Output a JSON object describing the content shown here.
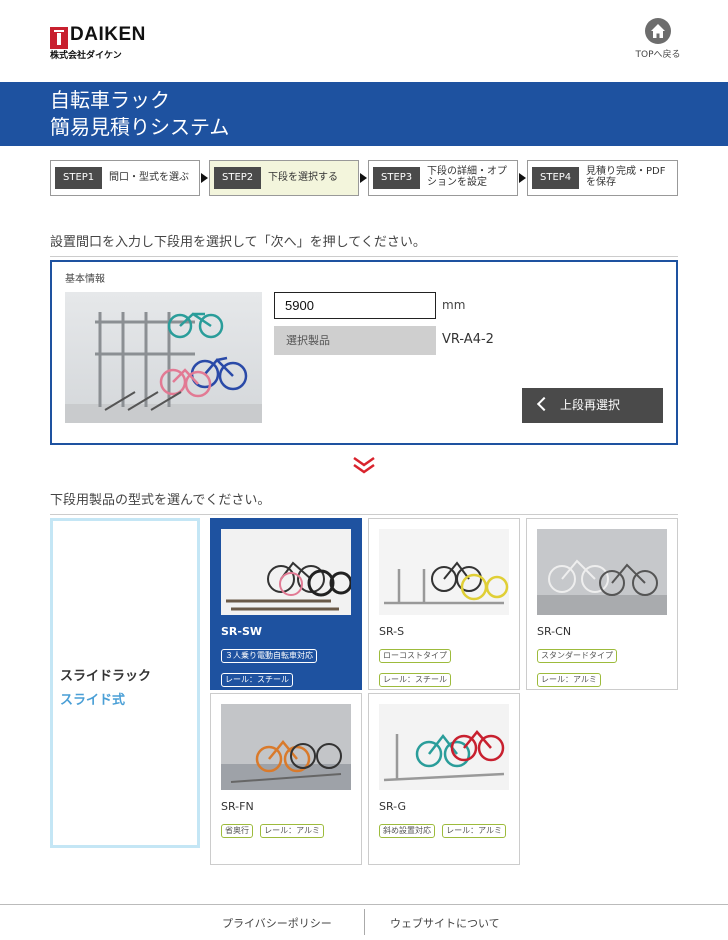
{
  "header": {
    "brand": "DAIKEN",
    "company": "株式会社ダイケン",
    "top_label": "TOPへ戻る",
    "top_icon": "home-icon"
  },
  "banner": {
    "title_line1": "自転車ラック",
    "title_line2": "簡易見積りシステム",
    "bg_color": "#1e52a0"
  },
  "steps": [
    {
      "badge": "STEP1",
      "text": [
        "間口・型式を選ぶ"
      ],
      "active": false
    },
    {
      "badge": "STEP2",
      "text": [
        "下段を選択する"
      ],
      "active": true
    },
    {
      "badge": "STEP3",
      "text": [
        "下段の詳細・オプ",
        "ションを設定"
      ],
      "active": false
    },
    {
      "badge": "STEP4",
      "text": [
        "見積り完成・PDF",
        "を保存"
      ],
      "active": false
    }
  ],
  "instruction": "設置間口を入力し下段用を選択して「次へ」を押してください。",
  "basic_info": {
    "label": "基本情報",
    "width_value": "5900",
    "unit": "mm",
    "selected_label": "選択製品",
    "selected_value": "VR-A4-2",
    "reselect_button": "上段再選択"
  },
  "lower_section": {
    "heading": "下段用製品の型式を選んでください。",
    "category_name": "スライドラック",
    "category_type": "スライド式"
  },
  "products": [
    {
      "name": "SR-SW",
      "tags": [
        "３人乗り電動自転車対応",
        "レール：スチール"
      ],
      "selected": true
    },
    {
      "name": "SR-S",
      "tags": [
        "ローコストタイプ",
        "レール：スチール"
      ],
      "selected": false
    },
    {
      "name": "SR-CN",
      "tags": [
        "スタンダードタイプ",
        "レール：アルミ"
      ],
      "selected": false
    },
    {
      "name": "SR-FN",
      "tags": [
        "省奥行",
        "レール：アルミ"
      ],
      "selected": false
    },
    {
      "name": "SR-G",
      "tags": [
        "斜め設置対応",
        "レール：アルミ"
      ],
      "selected": false
    }
  ],
  "footer": {
    "privacy": "プライバシーポリシー",
    "about": "ウェブサイトについて"
  },
  "colors": {
    "accent_blue": "#1e52a0",
    "brand_red": "#c8202f",
    "chevron_red": "#d9232d",
    "tag_green": "#9dbb3c"
  }
}
